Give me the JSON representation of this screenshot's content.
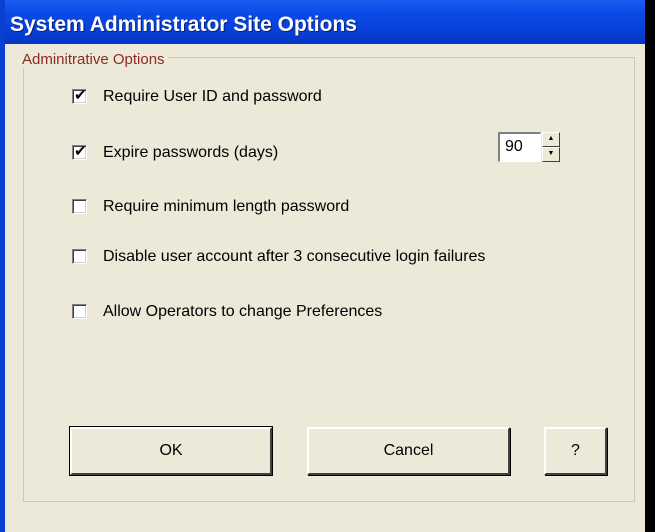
{
  "window": {
    "title": "System Administrator Site Options"
  },
  "group": {
    "legend": "Adminitrative Options"
  },
  "options": [
    {
      "label": "Require User ID and password",
      "checked": true
    },
    {
      "label": "Expire passwords (days)",
      "checked": true
    },
    {
      "label": "Require minimum length password",
      "checked": false
    },
    {
      "label": "Disable user account after 3 consecutive login failures",
      "checked": false
    },
    {
      "label": "Allow Operators to change Preferences",
      "checked": false
    }
  ],
  "expire_days": {
    "value": "90",
    "up_icon": "spin-up-arrow",
    "down_icon": "spin-down-arrow"
  },
  "buttons": {
    "ok": "OK",
    "cancel": "Cancel",
    "help": "?"
  },
  "colors": {
    "titlebar": "#0b4ae8",
    "dialog_bg": "#ece9d8",
    "legend_text": "#8c2a24"
  }
}
